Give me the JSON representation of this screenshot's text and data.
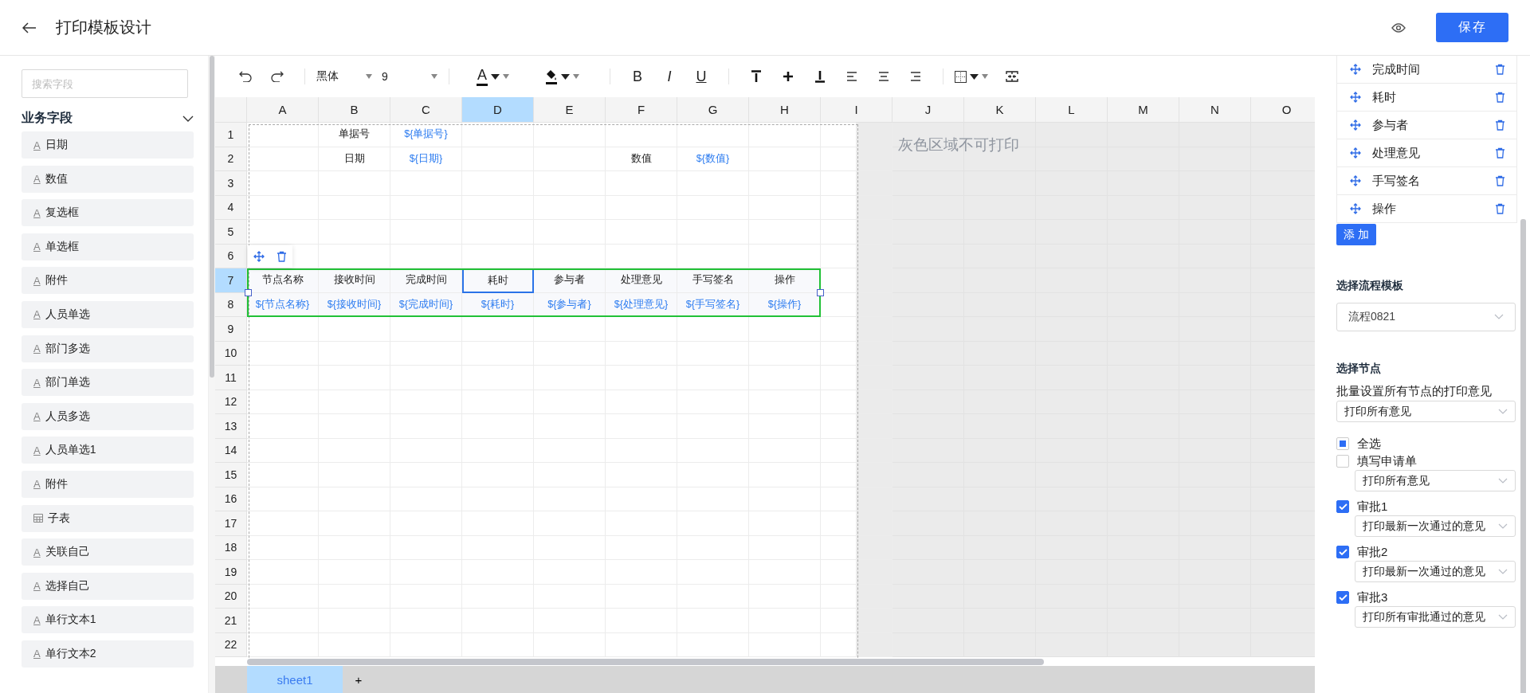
{
  "header": {
    "title": "打印模板设计",
    "save": "保存"
  },
  "toolbar": {
    "font": "黑体",
    "size": "9",
    "font_color_glyph": "A",
    "format_buttons": [
      "B",
      "I",
      "U"
    ]
  },
  "sidebar": {
    "search": {
      "placeholder": "搜索字段"
    },
    "section": {
      "title": "业务字段",
      "expanded": true
    },
    "fields": [
      {
        "kind": "text",
        "icon": "A",
        "label": "日期"
      },
      {
        "kind": "text",
        "icon": "A",
        "label": "数值"
      },
      {
        "kind": "text",
        "icon": "A",
        "label": "复选框"
      },
      {
        "kind": "text",
        "icon": "A",
        "label": "单选框"
      },
      {
        "kind": "text",
        "icon": "A",
        "label": "附件"
      },
      {
        "kind": "text",
        "icon": "A",
        "label": "人员单选"
      },
      {
        "kind": "text",
        "icon": "A",
        "label": "部门多选"
      },
      {
        "kind": "text",
        "icon": "A",
        "label": "部门单选"
      },
      {
        "kind": "text",
        "icon": "A",
        "label": "人员多选"
      },
      {
        "kind": "text",
        "icon": "A",
        "label": "人员单选1"
      },
      {
        "kind": "text",
        "icon": "A",
        "label": "附件"
      },
      {
        "kind": "table",
        "label": "子表"
      },
      {
        "kind": "text",
        "icon": "A",
        "label": "关联自己"
      },
      {
        "kind": "text",
        "icon": "A",
        "label": "选择自己"
      },
      {
        "kind": "text",
        "icon": "A",
        "label": "单行文本1"
      },
      {
        "kind": "text",
        "icon": "A",
        "label": "单行文本2"
      }
    ]
  },
  "sheet": {
    "columns": [
      {
        "label": "A",
        "selected": false
      },
      {
        "label": "B",
        "selected": false
      },
      {
        "label": "C",
        "selected": false
      },
      {
        "label": "D",
        "selected": true
      },
      {
        "label": "E",
        "selected": false
      },
      {
        "label": "F",
        "selected": false
      },
      {
        "label": "G",
        "selected": false
      },
      {
        "label": "H",
        "selected": false
      },
      {
        "label": "I",
        "selected": false
      },
      {
        "label": "J",
        "selected": false
      },
      {
        "label": "K",
        "selected": false
      },
      {
        "label": "L",
        "selected": false
      },
      {
        "label": "M",
        "selected": false
      },
      {
        "label": "N",
        "selected": false
      },
      {
        "label": "O",
        "selected": false
      }
    ],
    "rows": [
      {
        "label": "1",
        "selected": false,
        "cells": [
          null,
          {
            "text": "单据号",
            "kind": "label",
            "selected": false
          },
          {
            "text": "${单据号}",
            "kind": "field",
            "selected": false
          }
        ]
      },
      {
        "label": "2",
        "selected": false,
        "cells": [
          null,
          {
            "text": "日期",
            "kind": "label",
            "selected": false
          },
          {
            "text": "${日期}",
            "kind": "field",
            "selected": false
          },
          null,
          null,
          {
            "text": "数值",
            "kind": "label",
            "selected": false
          },
          {
            "text": "${数值}",
            "kind": "field",
            "selected": false
          }
        ]
      },
      {
        "label": "3",
        "selected": false
      },
      {
        "label": "4",
        "selected": false
      },
      {
        "label": "5",
        "selected": false
      },
      {
        "label": "6",
        "selected": false
      },
      {
        "label": "7",
        "selected": true,
        "cells": [
          {
            "text": "节点名称",
            "kind": "label",
            "selected": false
          },
          {
            "text": "接收时间",
            "kind": "label",
            "selected": false
          },
          {
            "text": "完成时间",
            "kind": "label",
            "selected": false
          },
          {
            "text": "耗时",
            "kind": "label",
            "selected": true
          },
          {
            "text": "参与者",
            "kind": "label",
            "selected": false
          },
          {
            "text": "处理意见",
            "kind": "label",
            "selected": false
          },
          {
            "text": "手写签名",
            "kind": "label",
            "selected": false
          },
          {
            "text": "操作",
            "kind": "label",
            "selected": false
          }
        ]
      },
      {
        "label": "8",
        "selected": false,
        "cells": [
          {
            "text": "${节点名称}",
            "kind": "field",
            "selected": false
          },
          {
            "text": "${接收时间}",
            "kind": "field",
            "selected": false
          },
          {
            "text": "${完成时间}",
            "kind": "field",
            "selected": false
          },
          {
            "text": "${耗时}",
            "kind": "field",
            "selected": false
          },
          {
            "text": "${参与者}",
            "kind": "field",
            "selected": false
          },
          {
            "text": "${处理意见}",
            "kind": "field",
            "selected": false
          },
          {
            "text": "${手写签名}",
            "kind": "field",
            "selected": false
          },
          {
            "text": "${操作}",
            "kind": "field",
            "selected": false
          }
        ]
      },
      {
        "label": "9",
        "selected": false
      },
      {
        "label": "10",
        "selected": false
      },
      {
        "label": "11",
        "selected": false
      },
      {
        "label": "12",
        "selected": false
      },
      {
        "label": "13",
        "selected": false
      },
      {
        "label": "14",
        "selected": false
      },
      {
        "label": "15",
        "selected": false
      },
      {
        "label": "16",
        "selected": false
      },
      {
        "label": "17",
        "selected": false
      },
      {
        "label": "18",
        "selected": false
      },
      {
        "label": "19",
        "selected": false
      },
      {
        "label": "20",
        "selected": false
      },
      {
        "label": "21",
        "selected": false
      },
      {
        "label": "22",
        "selected": false
      }
    ],
    "non_print_note": "灰色区域不可打印",
    "tabs": [
      {
        "label": "sheet1",
        "selected": true
      }
    ],
    "add_tab": "+"
  },
  "panel": {
    "table_columns": [
      "完成时间",
      "耗时",
      "参与者",
      "处理意见",
      "手写签名",
      "操作"
    ],
    "add": "添 加",
    "template": {
      "title": "选择流程模板",
      "value": "流程0821"
    },
    "nodes": {
      "title": "选择节点",
      "batch_label": "批量设置所有节点的打印意见",
      "batch_value": "打印所有意见",
      "select_all": {
        "label": "全选",
        "checked": false,
        "indeterminate": true
      },
      "items": [
        {
          "label": "填写申请单",
          "checked": false,
          "option": "打印所有意见"
        },
        {
          "label": "审批1",
          "checked": true,
          "option": "打印最新一次通过的意见"
        },
        {
          "label": "审批2",
          "checked": true,
          "option": "打印最新一次通过的意见"
        },
        {
          "label": "审批3",
          "checked": true,
          "option": "打印所有审批通过的意见"
        }
      ]
    }
  }
}
